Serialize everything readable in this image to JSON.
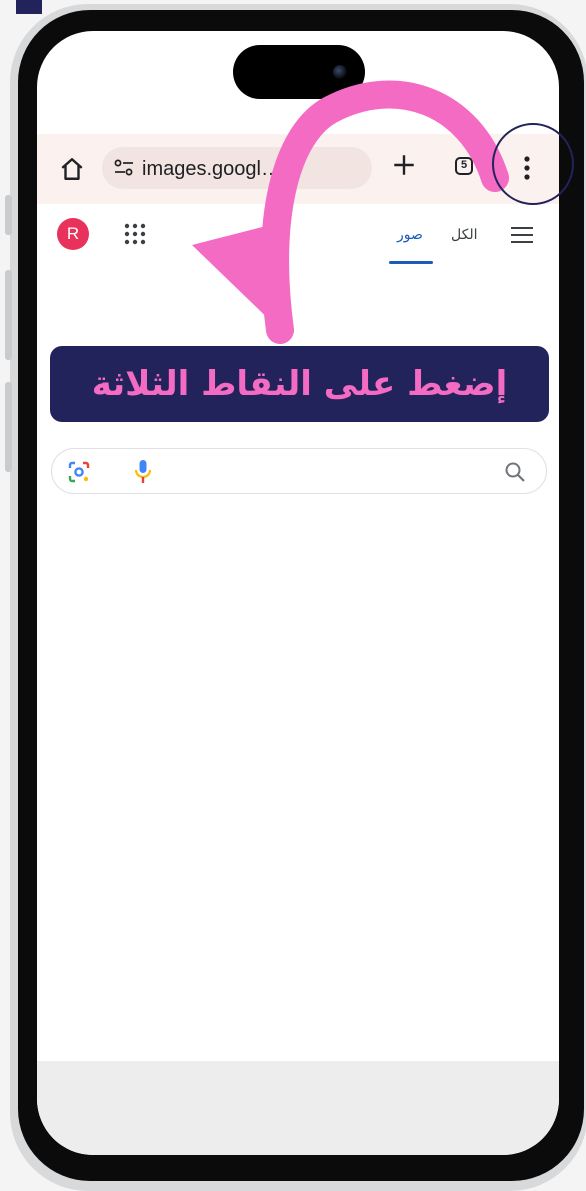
{
  "browser": {
    "url": "images.googl…m",
    "tab_count": "5"
  },
  "google": {
    "avatar_initial": "R",
    "tab_images": "صور",
    "tab_all": "الكل"
  },
  "tutorial": {
    "instruction": "إضغط على النقاط الثلاثة",
    "arrow_color": "#f46bc4",
    "banner_color": "#23235b"
  },
  "icons": [
    "home-icon",
    "site-settings-icon",
    "plus-icon",
    "tabs-icon",
    "more-vert-icon",
    "apps-grid-icon",
    "menu-icon",
    "google-lens-icon",
    "microphone-icon",
    "search-icon"
  ]
}
